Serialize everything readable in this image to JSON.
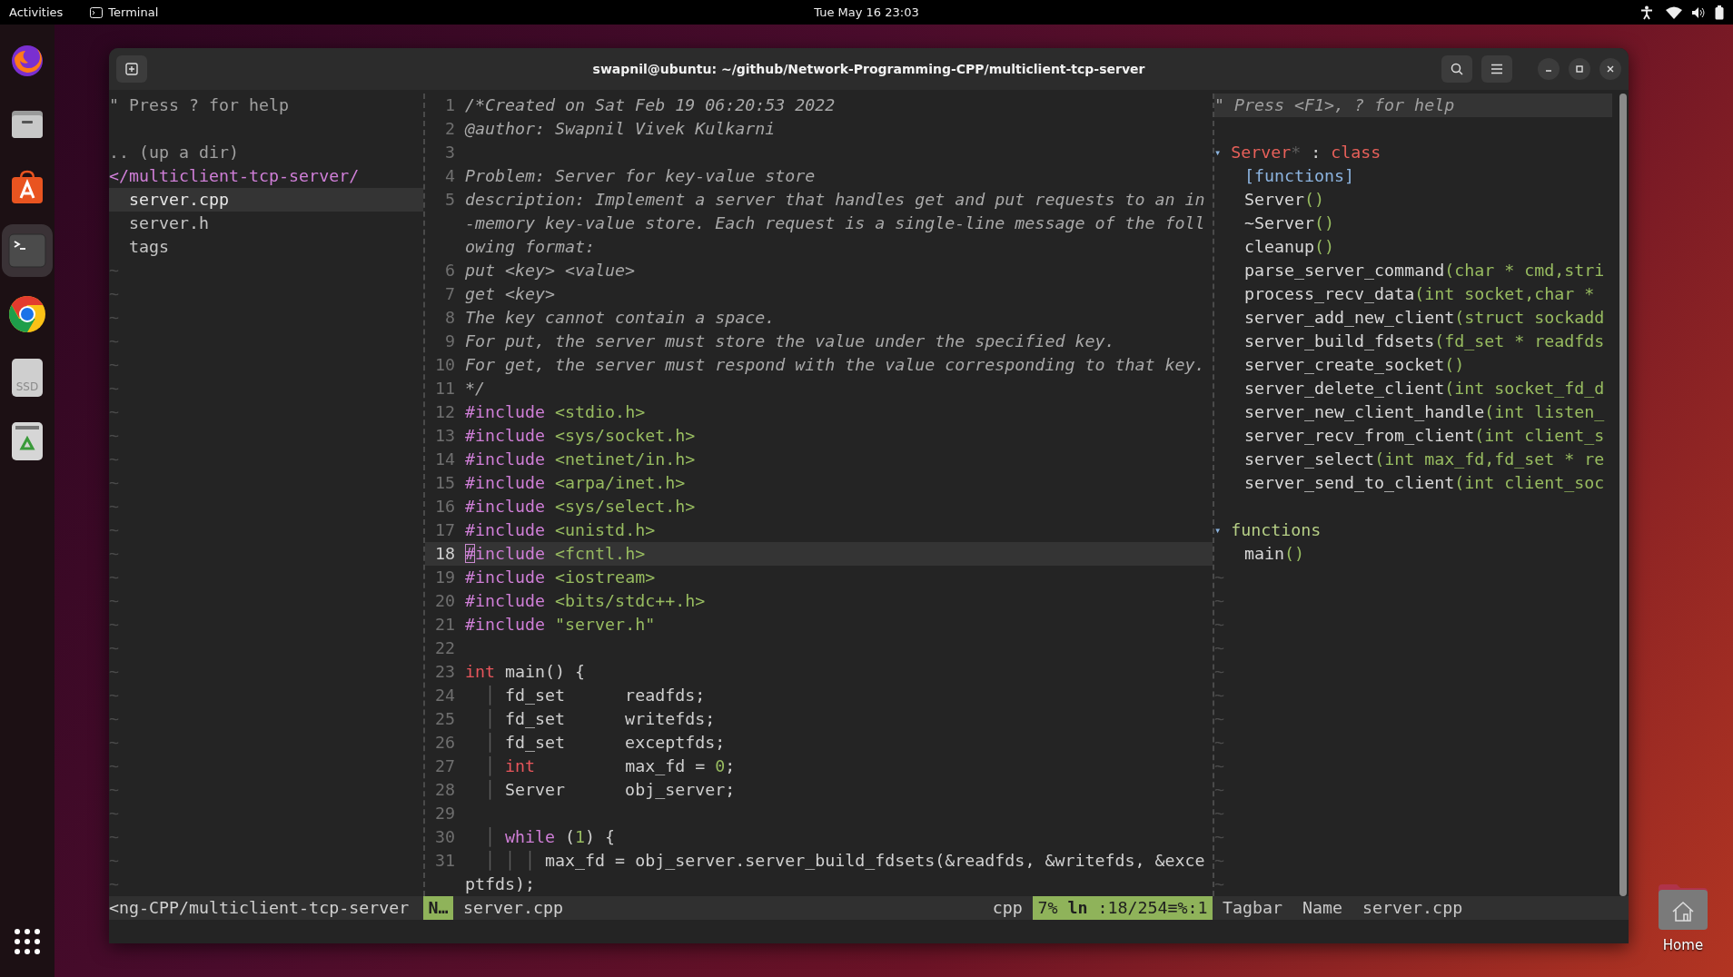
{
  "top_bar": {
    "activities": "Activities",
    "app": "Terminal",
    "clock": "Tue May 16  23:03"
  },
  "dock": {
    "items": [
      {
        "kind": "firefox",
        "selected": false
      },
      {
        "kind": "files",
        "selected": false
      },
      {
        "kind": "store",
        "selected": false
      },
      {
        "kind": "terminal",
        "selected": true
      },
      {
        "kind": "chrome",
        "selected": false
      },
      {
        "kind": "drive",
        "selected": false,
        "label": "SSD"
      },
      {
        "kind": "trash",
        "selected": false
      },
      {
        "kind": "apps",
        "selected": false
      }
    ]
  },
  "desktop_icons": [
    {
      "label": "Home"
    }
  ],
  "window": {
    "title": "swapnil@ubuntu: ~/github/Network-Programming-CPP/multiclient-tcp-server"
  },
  "file_tree": {
    "help": "\" Press ? for help",
    "up": ".. (up a dir)",
    "directory": "</multiclient-tcp-server/",
    "files": [
      {
        "name": "server.cpp",
        "selected": true
      },
      {
        "name": "server.h",
        "selected": false
      },
      {
        "name": "tags",
        "selected": false
      }
    ],
    "fillers": [
      "~",
      "~",
      "~",
      "~",
      "~",
      "~",
      "~",
      "~",
      "~",
      "~",
      "~",
      "~",
      "~",
      "~",
      "~",
      "~",
      "~",
      "~",
      "~",
      "~",
      "~",
      "~",
      "~",
      "~",
      "~",
      "~",
      "~"
    ]
  },
  "editor": {
    "lines": [
      {
        "number": "1",
        "selected": false,
        "rows": [
          [
            {
              "kind": "comment",
              "text": "/*Created on Sat Feb 19 06:20:53 2022"
            }
          ]
        ]
      },
      {
        "number": "2",
        "selected": false,
        "rows": [
          [
            {
              "kind": "comment",
              "text": "@author: Swapnil Vivek Kulkarni"
            }
          ]
        ]
      },
      {
        "number": "3",
        "selected": false,
        "rows": [
          []
        ]
      },
      {
        "number": "4",
        "selected": false,
        "rows": [
          [
            {
              "kind": "comment",
              "text": "Problem: Server for key-value store"
            }
          ]
        ]
      },
      {
        "number": "5",
        "selected": false,
        "rows": [
          [
            {
              "kind": "comment",
              "text": "description: Implement a server that handles get and put requests to an in"
            }
          ],
          [
            {
              "kind": "comment",
              "text": "-memory key-value store. Each request is a single-line message of the foll"
            }
          ],
          [
            {
              "kind": "comment",
              "text": "owing format:"
            }
          ]
        ]
      },
      {
        "number": "6",
        "selected": false,
        "rows": [
          [
            {
              "kind": "comment",
              "text": "put <key> <value>"
            }
          ]
        ]
      },
      {
        "number": "7",
        "selected": false,
        "rows": [
          [
            {
              "kind": "comment",
              "text": "get <key>"
            }
          ]
        ]
      },
      {
        "number": "8",
        "selected": false,
        "rows": [
          [
            {
              "kind": "comment",
              "text": "The key cannot contain a space."
            }
          ]
        ]
      },
      {
        "number": "9",
        "selected": false,
        "rows": [
          [
            {
              "kind": "comment",
              "text": "For put, the server must store the value under the specified key."
            }
          ]
        ]
      },
      {
        "number": "10",
        "selected": false,
        "rows": [
          [
            {
              "kind": "comment",
              "text": "For get, the server must respond with the value corresponding to that key."
            }
          ]
        ]
      },
      {
        "number": "11",
        "selected": false,
        "rows": [
          [
            {
              "kind": "comment",
              "text": "*/"
            }
          ]
        ]
      },
      {
        "number": "12",
        "selected": false,
        "rows": [
          [
            {
              "kind": "preproc",
              "text": "#include"
            },
            {
              "kind": "string",
              "text": " <stdio.h>"
            }
          ]
        ]
      },
      {
        "number": "13",
        "selected": false,
        "rows": [
          [
            {
              "kind": "preproc",
              "text": "#include"
            },
            {
              "kind": "string",
              "text": " <sys/socket.h>"
            }
          ]
        ]
      },
      {
        "number": "14",
        "selected": false,
        "rows": [
          [
            {
              "kind": "preproc",
              "text": "#include"
            },
            {
              "kind": "string",
              "text": " <netinet/in.h>"
            }
          ]
        ]
      },
      {
        "number": "15",
        "selected": false,
        "rows": [
          [
            {
              "kind": "preproc",
              "text": "#include"
            },
            {
              "kind": "string",
              "text": " <arpa/inet.h>"
            }
          ]
        ]
      },
      {
        "number": "16",
        "selected": false,
        "rows": [
          [
            {
              "kind": "preproc",
              "text": "#include"
            },
            {
              "kind": "string",
              "text": " <sys/select.h>"
            }
          ]
        ]
      },
      {
        "number": "17",
        "selected": false,
        "rows": [
          [
            {
              "kind": "preproc",
              "text": "#include"
            },
            {
              "kind": "string",
              "text": " <unistd.h>"
            }
          ]
        ]
      },
      {
        "number": "18",
        "selected": true,
        "rows": [
          [
            {
              "kind": "preproc",
              "text": "#include"
            },
            {
              "kind": "string",
              "text": " <fcntl.h>"
            }
          ]
        ]
      },
      {
        "number": "19",
        "selected": false,
        "rows": [
          [
            {
              "kind": "preproc",
              "text": "#include"
            },
            {
              "kind": "string",
              "text": " <iostream>"
            }
          ]
        ]
      },
      {
        "number": "20",
        "selected": false,
        "rows": [
          [
            {
              "kind": "preproc",
              "text": "#include"
            },
            {
              "kind": "string",
              "text": " <bits/stdc++.h>"
            }
          ]
        ]
      },
      {
        "number": "21",
        "selected": false,
        "rows": [
          [
            {
              "kind": "preproc",
              "text": "#include"
            },
            {
              "kind": "string",
              "text": " \"server.h\""
            }
          ]
        ]
      },
      {
        "number": "22",
        "selected": false,
        "rows": [
          []
        ]
      },
      {
        "number": "23",
        "selected": false,
        "rows": [
          [
            {
              "kind": "type",
              "text": "int"
            },
            {
              "kind": "plain",
              "text": " main() {"
            }
          ]
        ]
      },
      {
        "number": "24",
        "selected": false,
        "rows": [
          [
            {
              "kind": "guide",
              "text": "  │ "
            },
            {
              "kind": "plain",
              "text": "fd_set      readfds;"
            }
          ]
        ]
      },
      {
        "number": "25",
        "selected": false,
        "rows": [
          [
            {
              "kind": "guide",
              "text": "  │ "
            },
            {
              "kind": "plain",
              "text": "fd_set      writefds;"
            }
          ]
        ]
      },
      {
        "number": "26",
        "selected": false,
        "rows": [
          [
            {
              "kind": "guide",
              "text": "  │ "
            },
            {
              "kind": "plain",
              "text": "fd_set      exceptfds;"
            }
          ]
        ]
      },
      {
        "number": "27",
        "selected": false,
        "rows": [
          [
            {
              "kind": "guide",
              "text": "  │ "
            },
            {
              "kind": "type",
              "text": "int"
            },
            {
              "kind": "plain",
              "text": "         max_fd = "
            },
            {
              "kind": "number",
              "text": "0"
            },
            {
              "kind": "plain",
              "text": ";"
            }
          ]
        ]
      },
      {
        "number": "28",
        "selected": false,
        "rows": [
          [
            {
              "kind": "guide",
              "text": "  │ "
            },
            {
              "kind": "plain",
              "text": "Server      obj_server;"
            }
          ]
        ]
      },
      {
        "number": "29",
        "selected": false,
        "rows": [
          []
        ]
      },
      {
        "number": "30",
        "selected": false,
        "rows": [
          [
            {
              "kind": "guide",
              "text": "  │ "
            },
            {
              "kind": "flow",
              "text": "while"
            },
            {
              "kind": "plain",
              "text": " ("
            },
            {
              "kind": "number",
              "text": "1"
            },
            {
              "kind": "plain",
              "text": ") {"
            }
          ]
        ]
      },
      {
        "number": "31",
        "selected": false,
        "rows": [
          [
            {
              "kind": "guide",
              "text": "  │ │ │ "
            },
            {
              "kind": "plain",
              "text": "max_fd = obj_server.server_build_fdsets(&readfds, &writefds, &exce"
            }
          ],
          [
            {
              "kind": "plain",
              "text": "ptfds);"
            }
          ]
        ]
      }
    ]
  },
  "tagbar": {
    "help": "\" Press <F1>, ? for help",
    "groups": [
      {
        "fold": "▾",
        "header": [
          {
            "kind": "classname",
            "text": "Server"
          },
          {
            "kind": "dim",
            "text": "*"
          },
          {
            "kind": "plain",
            "text": " : "
          },
          {
            "kind": "classname",
            "text": "class"
          }
        ],
        "items": [
          [
            {
              "kind": "label",
              "text": "[functions]"
            }
          ],
          [
            {
              "kind": "name",
              "text": "Server"
            },
            {
              "kind": "signature",
              "text": "()"
            }
          ],
          [
            {
              "kind": "name",
              "text": "~Server"
            },
            {
              "kind": "signature",
              "text": "()"
            }
          ],
          [
            {
              "kind": "name",
              "text": "cleanup"
            },
            {
              "kind": "signature",
              "text": "()"
            }
          ],
          [
            {
              "kind": "name",
              "text": "parse_server_command"
            },
            {
              "kind": "signature",
              "text": "(char * cmd,stri"
            }
          ],
          [
            {
              "kind": "name",
              "text": "process_recv_data"
            },
            {
              "kind": "signature",
              "text": "(int socket,char *"
            }
          ],
          [
            {
              "kind": "name",
              "text": "server_add_new_client"
            },
            {
              "kind": "signature",
              "text": "(struct sockadd"
            }
          ],
          [
            {
              "kind": "name",
              "text": "server_build_fdsets"
            },
            {
              "kind": "signature",
              "text": "(fd_set * readfds"
            }
          ],
          [
            {
              "kind": "name",
              "text": "server_create_socket"
            },
            {
              "kind": "signature",
              "text": "()"
            }
          ],
          [
            {
              "kind": "name",
              "text": "server_delete_client"
            },
            {
              "kind": "signature",
              "text": "(int socket_fd_d"
            }
          ],
          [
            {
              "kind": "name",
              "text": "server_new_client_handle"
            },
            {
              "kind": "signature",
              "text": "(int listen_"
            }
          ],
          [
            {
              "kind": "name",
              "text": "server_recv_from_client"
            },
            {
              "kind": "signature",
              "text": "(int client_s"
            }
          ],
          [
            {
              "kind": "name",
              "text": "server_select"
            },
            {
              "kind": "signature",
              "text": "(int max_fd,fd_set * re"
            }
          ],
          [
            {
              "kind": "name",
              "text": "server_send_to_client"
            },
            {
              "kind": "signature",
              "text": "(int client_soc"
            }
          ]
        ]
      },
      {
        "fold": "▾",
        "header": [
          {
            "kind": "scope",
            "text": "functions"
          }
        ],
        "items": [
          [
            {
              "kind": "name",
              "text": "main"
            },
            {
              "kind": "signature",
              "text": "()"
            }
          ]
        ]
      }
    ],
    "fillers": [
      "~",
      "~",
      "~",
      "~",
      "~",
      "~",
      "~",
      "~",
      "~",
      "~",
      "~",
      "~",
      "~",
      "~"
    ]
  },
  "status_line": {
    "path": "<ng-CPP/multiclient-tcp-server",
    "mode": "N…",
    "file": "server.cpp",
    "filetype": "cpp",
    "position": "7% **ln** :18/254≡%:1",
    "tagbar": [
      "Tagbar",
      "Name",
      "server.cpp"
    ]
  }
}
